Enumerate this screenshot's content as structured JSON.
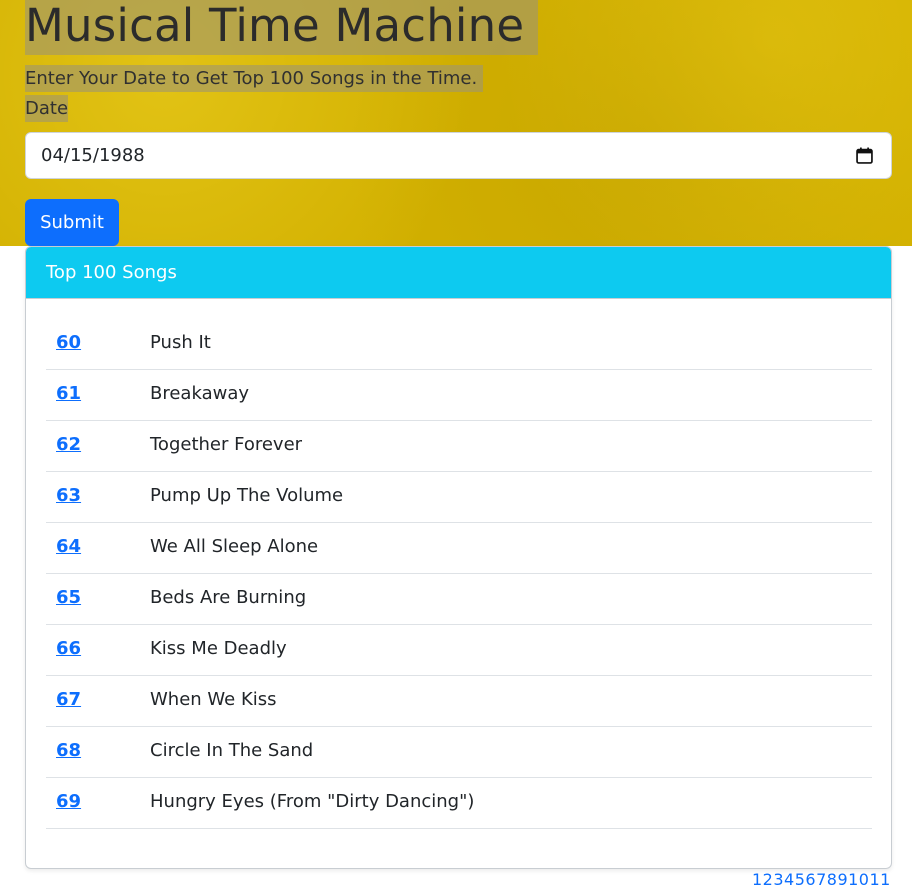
{
  "header": {
    "title": "Musical Time Machine",
    "subtitle": "Enter Your Date to Get Top 100 Songs in the Time.",
    "date_label": "Date",
    "date_value": "04/15/1988",
    "submit_label": "Submit"
  },
  "card": {
    "title": "Top 100 Songs",
    "songs": [
      {
        "rank": "60",
        "title": "Push It"
      },
      {
        "rank": "61",
        "title": "Breakaway"
      },
      {
        "rank": "62",
        "title": "Together Forever"
      },
      {
        "rank": "63",
        "title": "Pump Up The Volume"
      },
      {
        "rank": "64",
        "title": "We All Sleep Alone"
      },
      {
        "rank": "65",
        "title": "Beds Are Burning"
      },
      {
        "rank": "66",
        "title": "Kiss Me Deadly"
      },
      {
        "rank": "67",
        "title": "When We Kiss"
      },
      {
        "rank": "68",
        "title": "Circle In The Sand"
      },
      {
        "rank": "69",
        "title": "Hungry Eyes (From \"Dirty Dancing\")"
      }
    ]
  },
  "pagination": {
    "text": "1234567891011"
  },
  "colors": {
    "hero_background": "#d2b000",
    "primary": "#0d6efd",
    "card_header": "#0dcaf0"
  },
  "icons": {
    "date_picker": "calendar-icon"
  }
}
